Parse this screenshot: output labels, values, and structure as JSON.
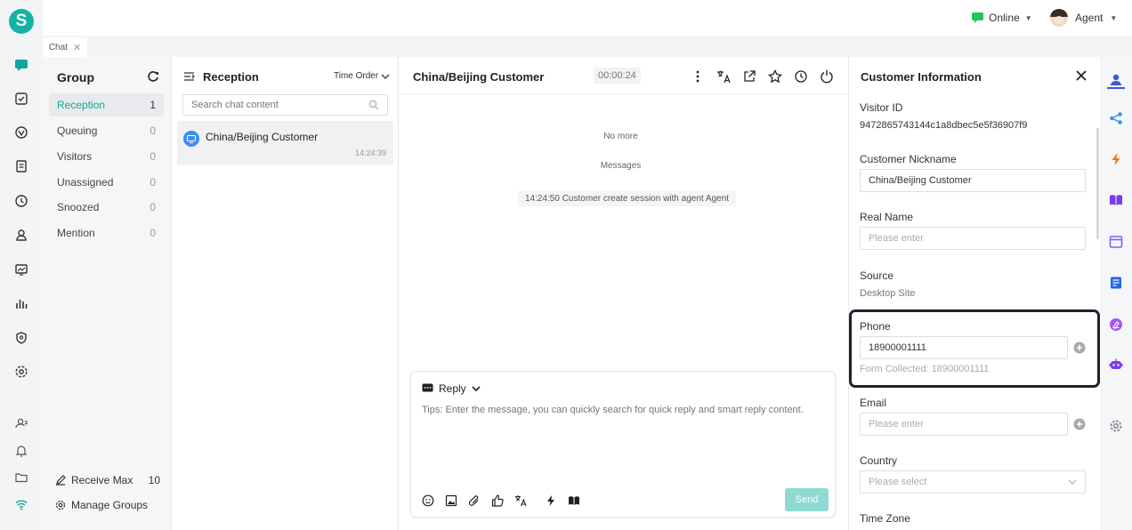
{
  "app": {
    "logo_letter": "S"
  },
  "topbar": {
    "status": "Online",
    "agent": "Agent"
  },
  "tabs": [
    {
      "label": "Chat"
    }
  ],
  "group": {
    "title": "Group",
    "items": [
      {
        "label": "Reception",
        "count": "1"
      },
      {
        "label": "Queuing",
        "count": "0"
      },
      {
        "label": "Visitors",
        "count": "0"
      },
      {
        "label": "Unassigned",
        "count": "0"
      },
      {
        "label": "Snoozed",
        "count": "0"
      },
      {
        "label": "Mention",
        "count": "0"
      }
    ],
    "receive_max_label": "Receive Max",
    "receive_max_value": "10",
    "manage_groups": "Manage Groups"
  },
  "reception": {
    "title": "Reception",
    "sort": "Time Order",
    "search_placeholder": "Search chat content",
    "sessions": [
      {
        "name": "China/Beijing Customer",
        "time": "14:24:39"
      }
    ]
  },
  "chat": {
    "title": "China/Beijing Customer",
    "timer": "00:00:24",
    "no_more": "No more",
    "messages_label": "Messages",
    "system_msg": "14:24:50 Customer create session with agent Agent",
    "reply_mode": "Reply",
    "input_placeholder": "Tips: Enter the message, you can quickly search for quick reply and smart reply content.",
    "send": "Send"
  },
  "info": {
    "title": "Customer Information",
    "visitor_id_label": "Visitor ID",
    "visitor_id": "9472865743144c1a8dbec5e5f36907f9",
    "nickname_label": "Customer Nickname",
    "nickname": "China/Beijing Customer",
    "realname_label": "Real Name",
    "please_enter": "Please enter",
    "source_label": "Source",
    "source": "Desktop Site",
    "phone_label": "Phone",
    "phone": "18900001111",
    "phone_collected": "Form Collected: 18900001111",
    "email_label": "Email",
    "country_label": "Country",
    "please_select": "Please select",
    "timezone_label": "Time Zone"
  },
  "colors": {
    "accent": "#11a79a",
    "send_disabled": "#8fd9d2",
    "online": "#22c55e"
  }
}
